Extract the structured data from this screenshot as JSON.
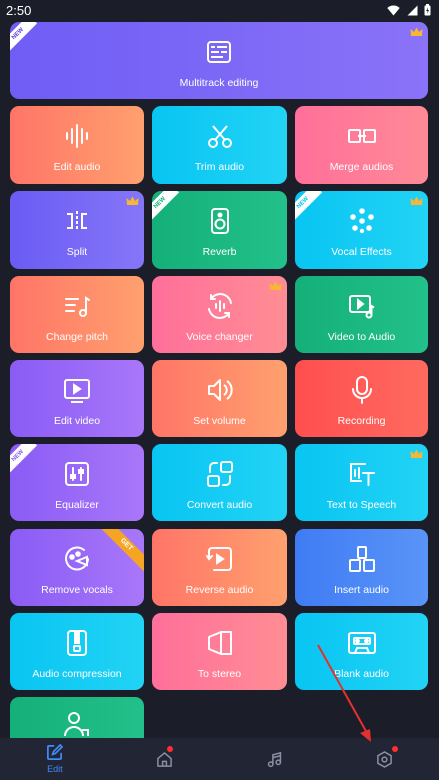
{
  "status_bar": {
    "time": "2:50"
  },
  "tiles": [
    {
      "label": "Multitrack editing",
      "badge_new": "NEW",
      "crown": true,
      "icon": "multitrack-icon"
    },
    {
      "label": "Edit audio",
      "icon": "waveform-icon"
    },
    {
      "label": "Trim audio",
      "icon": "scissors-icon"
    },
    {
      "label": "Merge audios",
      "icon": "merge-icon"
    },
    {
      "label": "Split",
      "crown": true,
      "icon": "split-icon"
    },
    {
      "label": "Reverb",
      "badge_new": "NEW",
      "icon": "speaker-icon"
    },
    {
      "label": "Vocal Effects",
      "badge_new": "NEW",
      "crown": true,
      "icon": "dots-cluster-icon"
    },
    {
      "label": "Change pitch",
      "icon": "pitch-icon"
    },
    {
      "label": "Voice changer",
      "crown": true,
      "icon": "voice-changer-icon"
    },
    {
      "label": "Video to Audio",
      "icon": "video-to-audio-icon"
    },
    {
      "label": "Edit video",
      "icon": "play-box-icon"
    },
    {
      "label": "Set volume",
      "icon": "volume-icon"
    },
    {
      "label": "Recording",
      "icon": "microphone-icon"
    },
    {
      "label": "Equalizer",
      "badge_new": "NEW",
      "icon": "equalizer-icon"
    },
    {
      "label": "Convert audio",
      "icon": "convert-icon"
    },
    {
      "label": "Text to Speech",
      "crown": true,
      "icon": "text-to-speech-icon"
    },
    {
      "label": "Remove vocals",
      "ribbon": "GET",
      "icon": "remove-vocals-icon"
    },
    {
      "label": "Reverse audio",
      "icon": "reverse-icon"
    },
    {
      "label": "Insert audio",
      "icon": "insert-icon"
    },
    {
      "label": "Audio compression",
      "icon": "zip-icon"
    },
    {
      "label": "To stereo",
      "icon": "stereo-icon"
    },
    {
      "label": "Blank audio",
      "icon": "cassette-icon"
    },
    {
      "label": "",
      "icon": "user-group-icon"
    }
  ],
  "bottom_nav": [
    {
      "label": "Edit",
      "icon": "edit-icon",
      "active": true
    },
    {
      "label": "",
      "icon": "home-icon",
      "dot": true
    },
    {
      "label": "",
      "icon": "music-note-icon"
    },
    {
      "label": "",
      "icon": "settings-icon",
      "dot": true
    }
  ],
  "colors": {
    "background": "#1b1e29",
    "accent": "#3f8cff",
    "purple": "#7b6cf6",
    "orange": "#ff7f66",
    "cyan": "#1ec8f0",
    "pink": "#ff6f9a",
    "green": "#19b67f",
    "red": "#ff4f4f"
  }
}
